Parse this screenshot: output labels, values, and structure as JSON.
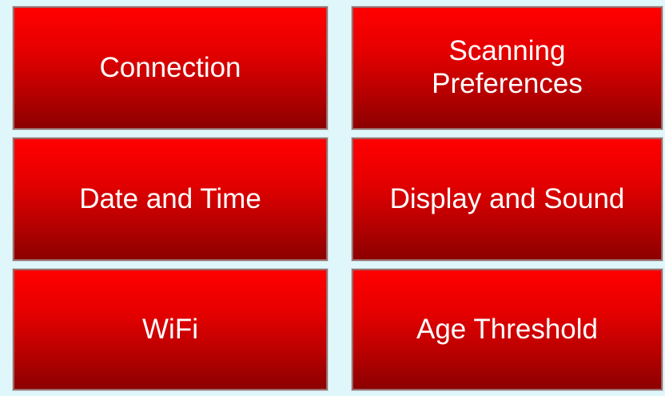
{
  "colors": {
    "background": "#dff7fb",
    "tile_top": "#ff0000",
    "tile_bottom": "#8c0000",
    "text": "#ffffff"
  },
  "menu": {
    "tiles": [
      {
        "label": "Connection"
      },
      {
        "label": "Scanning\nPreferences"
      },
      {
        "label": "Date and Time"
      },
      {
        "label": "Display and Sound"
      },
      {
        "label": "WiFi"
      },
      {
        "label": "Age Threshold"
      }
    ]
  }
}
